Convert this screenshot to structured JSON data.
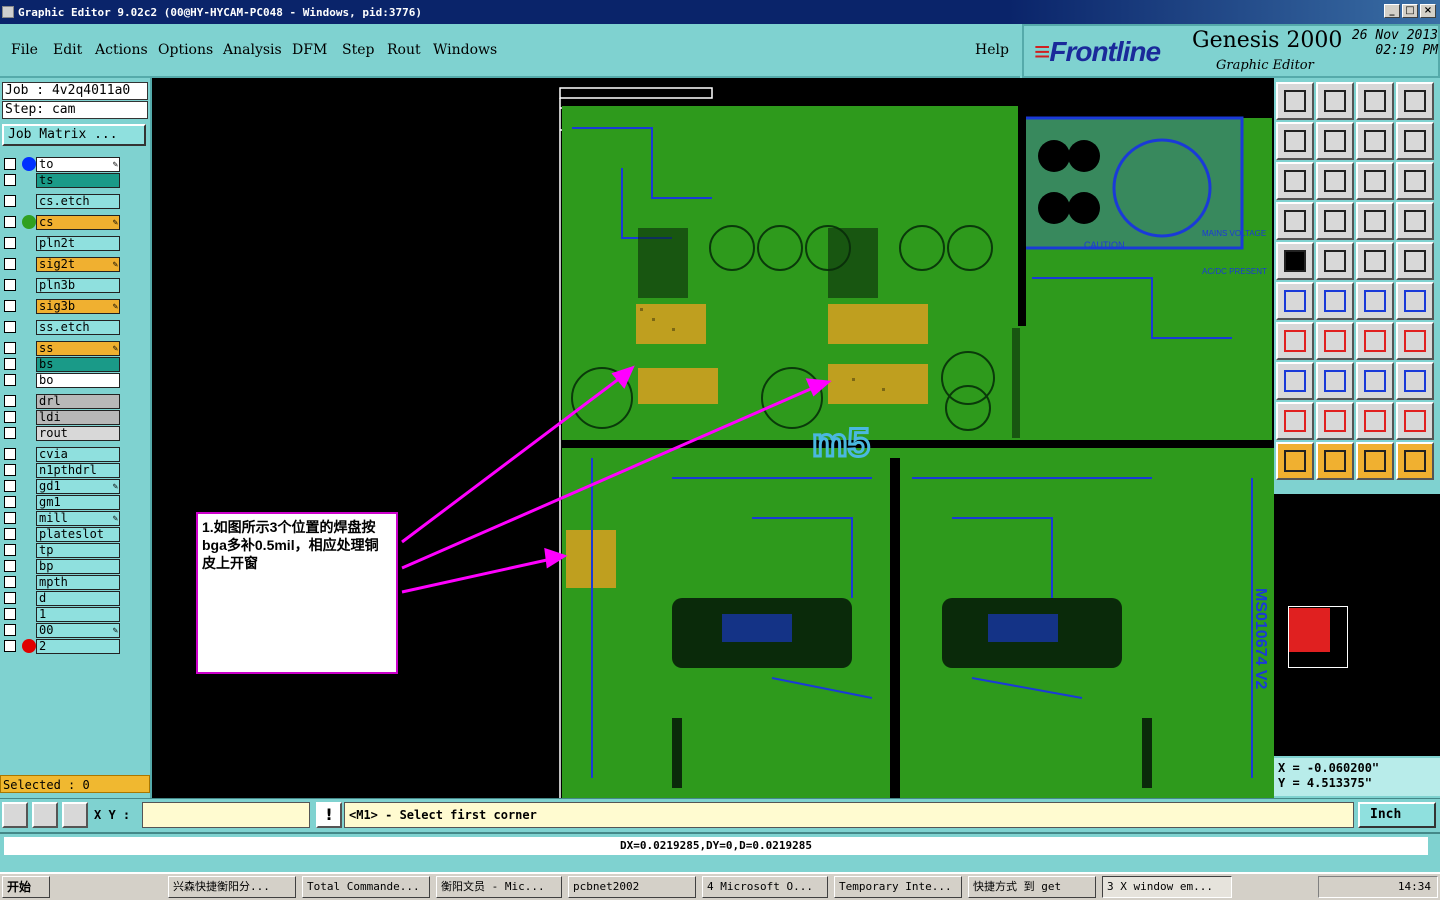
{
  "window": {
    "title": "Graphic Editor 9.02c2 (00@HY-HYCAM-PC048 - Windows, pid:3776)"
  },
  "menu": {
    "items": [
      "File",
      "Edit",
      "Actions",
      "Options",
      "Analysis",
      "DFM",
      "Step",
      "Rout",
      "Windows"
    ],
    "help": "Help"
  },
  "brand": {
    "logo": "Frontline",
    "product": "Genesis 2000",
    "subtitle": "Graphic Editor",
    "date": "26 Nov 2013",
    "time": "02:19 PM"
  },
  "job": {
    "job": "Job : 4v2q4011a0",
    "step": "Step: cam",
    "matrix_button": "Job Matrix ..."
  },
  "layers": [
    {
      "name": "to",
      "color": "#ffffff",
      "dot": "#0030ff",
      "pen": true
    },
    {
      "name": "ts",
      "color": "#1a9a88",
      "dot": "",
      "pen": false
    },
    {
      "name": "cs.etch",
      "color": "#8fe0de",
      "dot": "",
      "pen": false
    },
    {
      "name": "cs",
      "color": "#f0b030",
      "dot": "#30a020",
      "pen": true
    },
    {
      "name": "pln2t",
      "color": "#8fe0de",
      "dot": "",
      "pen": false
    },
    {
      "name": "sig2t",
      "color": "#f0b030",
      "dot": "",
      "pen": true
    },
    {
      "name": "pln3b",
      "color": "#8fe0de",
      "dot": "",
      "pen": false
    },
    {
      "name": "sig3b",
      "color": "#f0b030",
      "dot": "",
      "pen": true
    },
    {
      "name": "ss.etch",
      "color": "#8fe0de",
      "dot": "",
      "pen": false
    },
    {
      "name": "ss",
      "color": "#f0b030",
      "dot": "",
      "pen": true
    },
    {
      "name": "bs",
      "color": "#1a9a88",
      "dot": "",
      "pen": false
    },
    {
      "name": "bo",
      "color": "#ffffff",
      "dot": "",
      "pen": false
    },
    {
      "name": "drl",
      "color": "#b8b8b8",
      "dot": "",
      "pen": false
    },
    {
      "name": "ldi",
      "color": "#b8b8b8",
      "dot": "",
      "pen": false
    },
    {
      "name": "rout",
      "color": "#d8d8d8",
      "dot": "",
      "pen": false
    },
    {
      "name": "cvia",
      "color": "#8fe0de",
      "dot": "",
      "pen": false
    },
    {
      "name": "n1pthdrl",
      "color": "#8fe0de",
      "dot": "",
      "pen": false
    },
    {
      "name": "gd1",
      "color": "#8fe0de",
      "dot": "",
      "pen": true
    },
    {
      "name": "gm1",
      "color": "#8fe0de",
      "dot": "",
      "pen": false
    },
    {
      "name": "mill",
      "color": "#8fe0de",
      "dot": "",
      "pen": true
    },
    {
      "name": "plateslot",
      "color": "#8fe0de",
      "dot": "",
      "pen": false
    },
    {
      "name": "tp",
      "color": "#8fe0de",
      "dot": "",
      "pen": false
    },
    {
      "name": "bp",
      "color": "#8fe0de",
      "dot": "",
      "pen": false
    },
    {
      "name": "mpth",
      "color": "#8fe0de",
      "dot": "",
      "pen": false
    },
    {
      "name": "d",
      "color": "#8fe0de",
      "dot": "",
      "pen": false
    },
    {
      "name": "1",
      "color": "#8fe0de",
      "dot": "",
      "pen": false
    },
    {
      "name": "00",
      "color": "#8fe0de",
      "dot": "",
      "pen": true
    },
    {
      "name": "2",
      "color": "#8fe0de",
      "dot": "#e00000",
      "pen": false
    }
  ],
  "selected": "Selected : 0",
  "annotation": {
    "text": "1.如图所示3个位置的焊盘按bga多补0.5mil，相应处理铜皮上开窗"
  },
  "canvas": {
    "logo_text": "m5",
    "board_label": "MS010674 V2",
    "caution": "CAUTION",
    "mains": "MAINS VOLTAGE",
    "acdc": "AC/DC PRESENT"
  },
  "coords": {
    "x": "X = -0.060200\"",
    "y": "Y = 4.513375\""
  },
  "bottom": {
    "xy_label": "X Y :",
    "xy_value": "",
    "prompt": "<M1> - Select first corner",
    "unit": "Inch",
    "status": "DX=0.0219285,DY=0,D=0.0219285"
  },
  "taskbar": {
    "start": "开始",
    "tasks": [
      "兴森快捷衡阳分...",
      "Total Commande...",
      "衡阳文员 - Mic...",
      "pcbnet2002",
      "4 Microsoft O...",
      "Temporary Inte...",
      "快捷方式 到 get",
      "3 X window em..."
    ],
    "clock": "14:34"
  },
  "colors": {
    "bg": "#7fd2d0",
    "board": "#2e9a1c",
    "trace": "#1a3ad8",
    "arrow": "#ff00ff"
  }
}
